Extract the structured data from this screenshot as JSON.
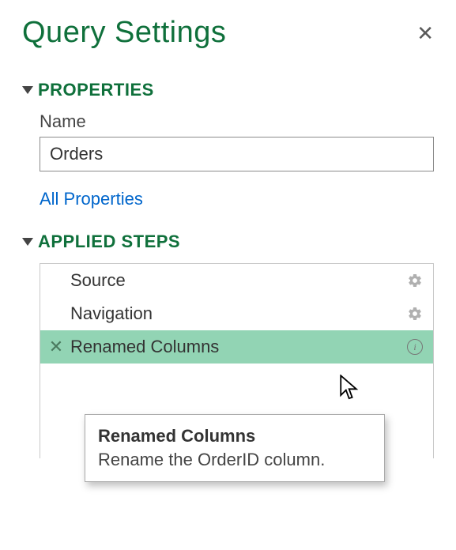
{
  "panel": {
    "title": "Query Settings",
    "sections": {
      "properties": {
        "heading": "PROPERTIES",
        "name_label": "Name",
        "name_value": "Orders",
        "all_props_link": "All Properties"
      },
      "applied_steps": {
        "heading": "APPLIED STEPS",
        "items": [
          {
            "label": "Source",
            "has_gear": true,
            "selected": false
          },
          {
            "label": "Navigation",
            "has_gear": true,
            "selected": false
          },
          {
            "label": "Renamed Columns",
            "has_gear": false,
            "has_info": true,
            "selected": true
          }
        ]
      }
    },
    "tooltip": {
      "title": "Renamed Columns",
      "description": "Rename the OrderID column."
    }
  }
}
